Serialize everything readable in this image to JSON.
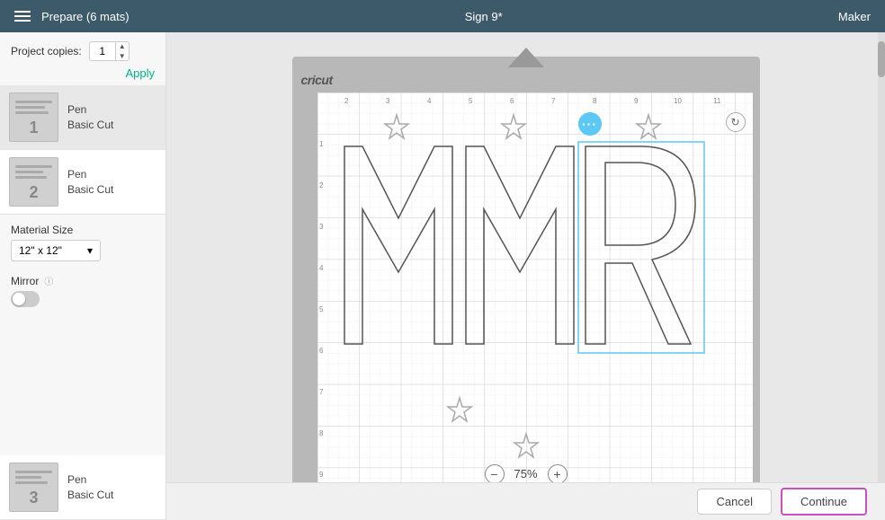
{
  "header": {
    "menu_label": "Menu",
    "title": "Prepare (6 mats)",
    "document_name": "Sign 9*",
    "machine": "Maker"
  },
  "sidebar": {
    "copies_label": "Project copies:",
    "copies_value": "1",
    "apply_label": "Apply",
    "mats": [
      {
        "number": "1",
        "title": "Pen",
        "subtitle": "Basic Cut",
        "active": true
      },
      {
        "number": "2",
        "title": "Pen",
        "subtitle": "Basic Cut",
        "active": false
      },
      {
        "number": "3",
        "title": "Pen",
        "subtitle": "Basic Cut",
        "active": false
      }
    ],
    "material_label": "Material Size",
    "material_value": "12\" x 12\"",
    "mirror_label": "Mirror",
    "zoom_minus": "−",
    "zoom_value": "75%",
    "zoom_plus": "+"
  },
  "footer": {
    "cancel_label": "Cancel",
    "continue_label": "Continue"
  },
  "canvas": {
    "brand": "cricut",
    "content": "MMR"
  }
}
